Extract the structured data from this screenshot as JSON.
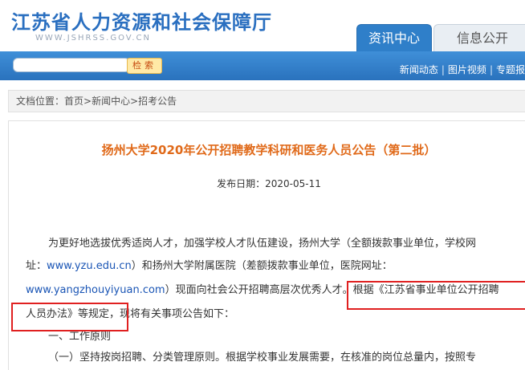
{
  "header": {
    "site_title": "江苏省人力资源和社会保障厅",
    "site_url": "WWW.JSHRSS.GOV.CN",
    "tabs": [
      {
        "label": "资讯中心",
        "active": true
      },
      {
        "label": "信息公开",
        "active": false
      }
    ]
  },
  "search": {
    "placeholder": "",
    "button_label": "检索"
  },
  "nav_links": [
    "新闻动态",
    "图片视频",
    "专题报"
  ],
  "breadcrumb": {
    "prefix": "文档位置：",
    "items": [
      "首页",
      "新闻中心",
      "招考公告"
    ],
    "separator": ">"
  },
  "article": {
    "title": "扬州大学2020年公开招聘教学科研和医务人员公告（第二批）",
    "date_label": "发布日期：",
    "date_value": "2020-05-11",
    "p1_line1": "为更好地选拔优秀适岗人才，加强学校人才队伍建设，扬州大学（全额拨款事业单位，学校网",
    "p1_line2_a": "址：",
    "link1": "www.yzu.edu.cn",
    "p1_line2_b": "）和扬州大学附属医院（差额拨款事业单位，医院网址：",
    "link2": "www.yangzhouyiyuan.com",
    "p1_line3_b": "）现面向社会公开招聘高层次优秀人才。根据《江苏省事业单位公开招聘",
    "p1_line4": "人员办法》等规定，现将有关事项公告如下：",
    "section1": "一、工作原则",
    "section1_item1": "（一）坚持按岗招聘、分类管理原则。根据学校事业发展需要，在核准的岗位总量内，按照专"
  },
  "colors": {
    "brand_blue": "#2a6fc0",
    "title_orange": "#e06a1a",
    "highlight_red": "#e02020",
    "link_blue": "#1a55b5"
  }
}
